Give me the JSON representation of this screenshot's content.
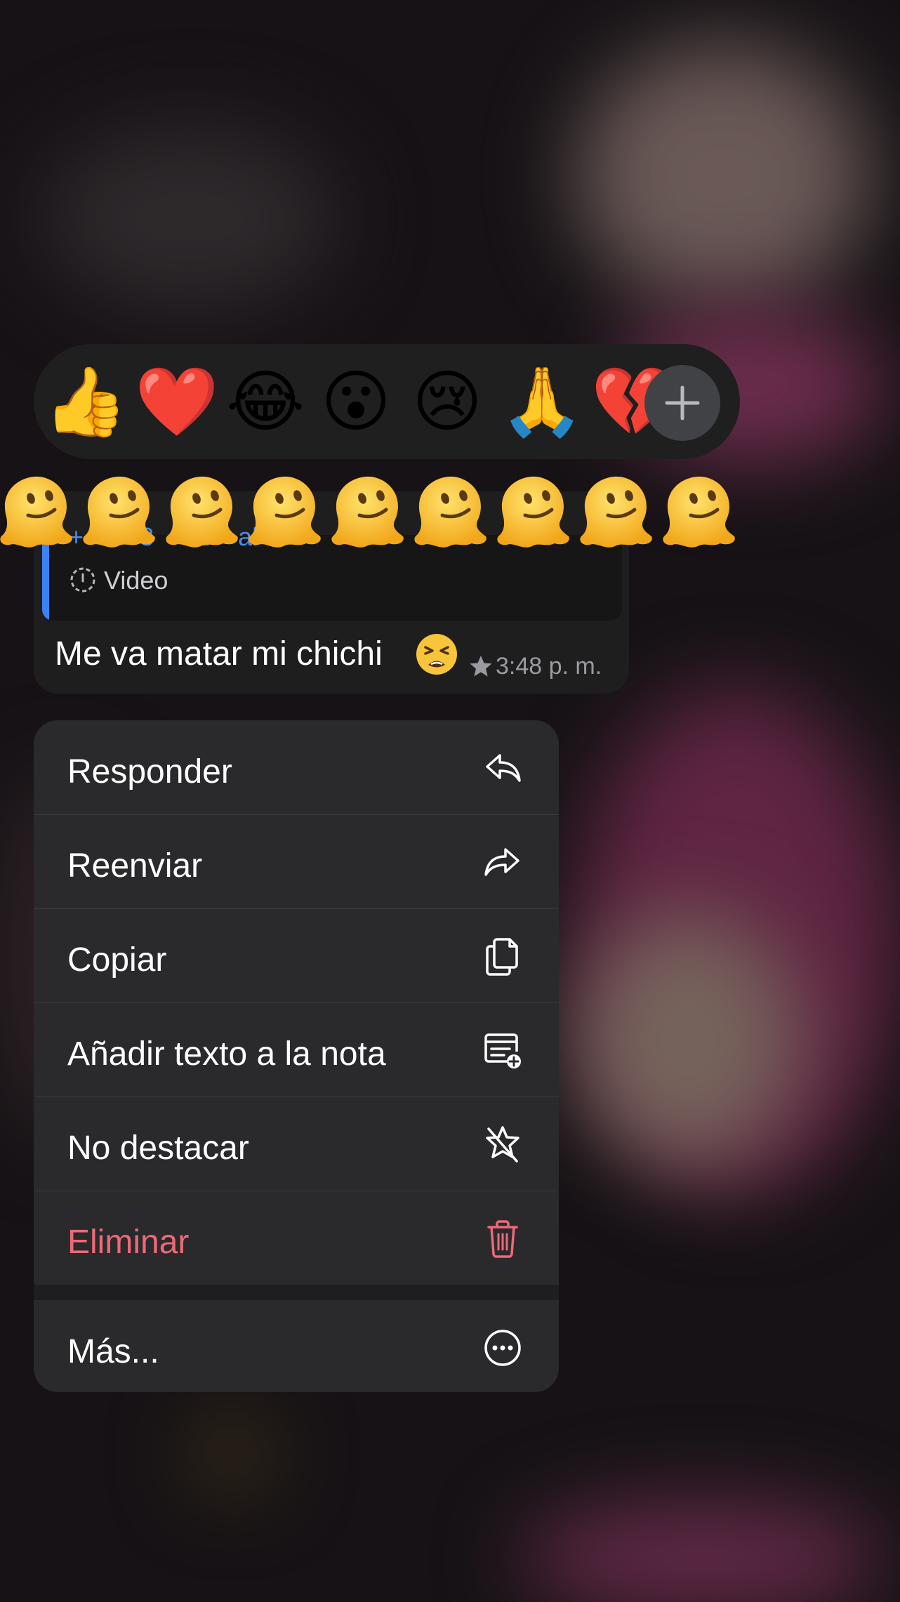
{
  "reactions": {
    "emojis": [
      "👍",
      "❤️",
      "😂",
      "😮",
      "😢",
      "🙏",
      "💔"
    ],
    "more_button_icon": "plus-icon"
  },
  "message": {
    "quote_sender_fragment": "+  4    8    31    al",
    "quote_type": "Video",
    "quote_icon": "timer-icon",
    "text": "Me va matar mi chichi",
    "emoji_icon": "tired-face-emoji",
    "starred_icon": "star-icon",
    "time": "3:48 p. m."
  },
  "overlay_emoji_icon": "melting-face-emoji",
  "menu": {
    "items": [
      {
        "label": "Responder",
        "icon": "reply-icon"
      },
      {
        "label": "Reenviar",
        "icon": "forward-icon"
      },
      {
        "label": "Copiar",
        "icon": "copy-icon"
      },
      {
        "label": "Añadir texto a la nota",
        "icon": "add-to-note-icon"
      },
      {
        "label": "No destacar",
        "icon": "unstar-icon"
      },
      {
        "label": "Eliminar",
        "icon": "trash-icon"
      },
      {
        "label": "Más...",
        "icon": "more-icon"
      }
    ],
    "danger_color": "#ec6a77"
  },
  "colors": {
    "accent_quote_bar": "#3b82f6",
    "bubble": "#1e1e1f",
    "menu": "#2a292b"
  }
}
